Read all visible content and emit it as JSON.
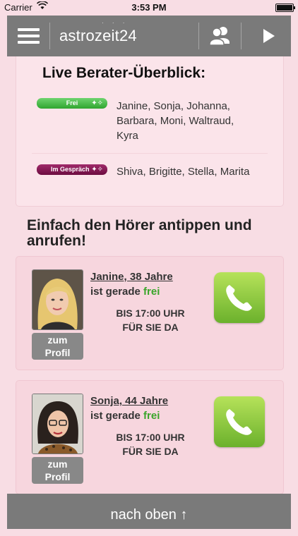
{
  "status_bar": {
    "carrier": "Carrier",
    "time": "3:53 PM"
  },
  "header": {
    "logo": "astrozeit24",
    "logo_stars": "· · ·"
  },
  "overview": {
    "title": "Live Berater-Überblick:",
    "free_badge": "Frei",
    "busy_badge": "Im Gespräch",
    "free_names": "Janine, Sonja, Johanna, Barbara, Moni, Waltraud, Kyra",
    "busy_names": "Shiva, Brigitte, Stella, Marita"
  },
  "cta": "Einfach den Hörer antippen und anrufen!",
  "advisors": [
    {
      "name": "Janine, 38 Jahre",
      "status_prefix": "ist gerade",
      "status": "frei",
      "hours_line1": "BIS 17:00 UHR",
      "hours_line2": "FÜR SIE DA",
      "profile_label_1": "zum",
      "profile_label_2": "Profil"
    },
    {
      "name": "Sonja, 44 Jahre",
      "status_prefix": "ist gerade",
      "status": "frei",
      "hours_line1": "BIS 17:00 UHR",
      "hours_line2": "FÜR SIE DA",
      "profile_label_1": "zum",
      "profile_label_2": "Profil"
    }
  ],
  "bottom": {
    "label": "nach oben ↑"
  },
  "icons": {
    "menu": "hamburger-icon",
    "users": "users-icon",
    "play": "play-icon",
    "phone": "phone-icon",
    "spark": "sparkle-icon"
  },
  "colors": {
    "header_bg": "#7a7a7a",
    "page_bg": "#f8dde4",
    "free_green": "#3aa52a",
    "busy_purple": "#7c1450",
    "call_green": "#8cc63f"
  }
}
